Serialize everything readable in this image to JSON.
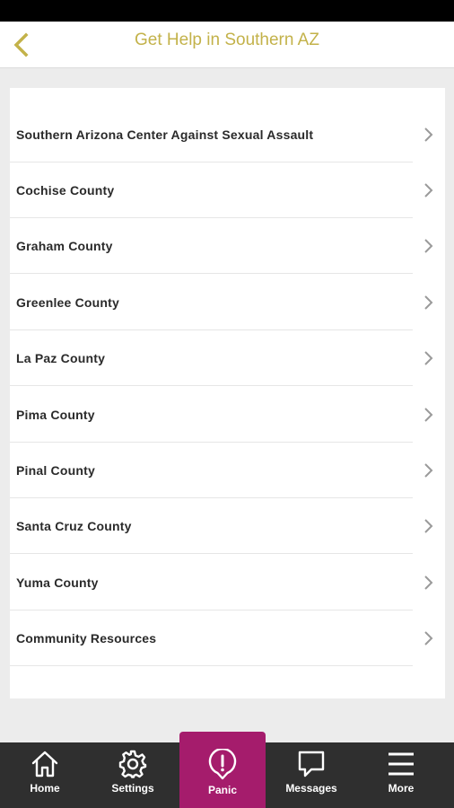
{
  "header": {
    "title": "Get Help in Southern AZ"
  },
  "list": {
    "items": [
      {
        "label": "Southern Arizona Center Against Sexual Assault"
      },
      {
        "label": "Cochise County"
      },
      {
        "label": "Graham County"
      },
      {
        "label": "Greenlee County"
      },
      {
        "label": "La Paz County"
      },
      {
        "label": "Pima County"
      },
      {
        "label": "Pinal County"
      },
      {
        "label": "Santa Cruz County"
      },
      {
        "label": "Yuma County"
      },
      {
        "label": "Community Resources"
      }
    ]
  },
  "tabs": {
    "home": "Home",
    "settings": "Settings",
    "panic": "Panic",
    "messages": "Messages",
    "more": "More"
  },
  "colors": {
    "accent": "#c3b24a",
    "panic": "#a51c6c",
    "tabbar": "#2f2f2f"
  },
  "icons": [
    "chevron-left-icon",
    "chevron-right-icon",
    "home-icon",
    "gear-icon",
    "alert-icon",
    "message-icon",
    "menu-icon"
  ]
}
